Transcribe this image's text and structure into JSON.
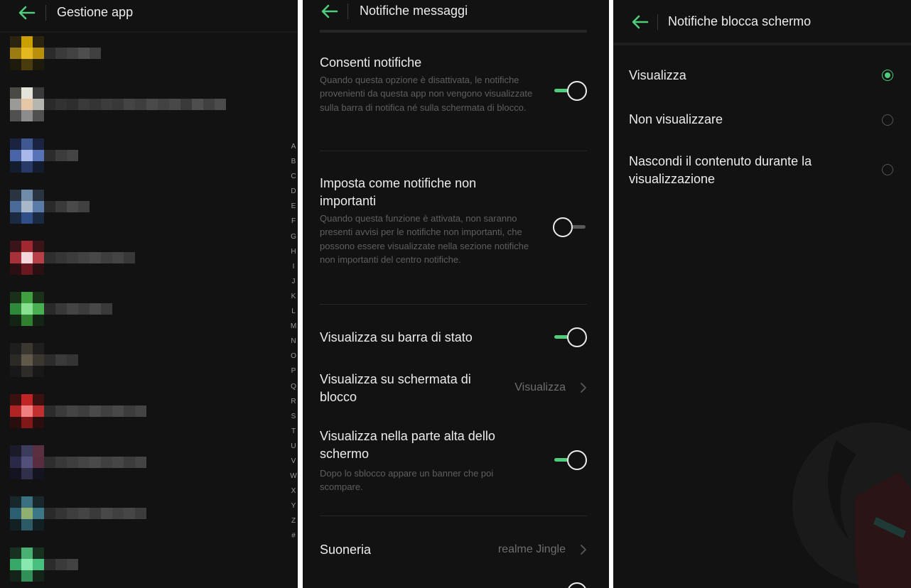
{
  "colors": {
    "accent": "#4fcc7c",
    "background": "#121212",
    "text_primary": "#ececec",
    "text_secondary": "#5f5f5f",
    "text_value": "#6e6e6e"
  },
  "panel_app_management": {
    "title": "Gestione app",
    "back_icon": "arrow-left-icon",
    "apps": [
      {
        "icon_colors": [
          [
            "#2a2410",
            "#caa000",
            "#2a2410"
          ],
          [
            "#9a7c10",
            "#e6b820",
            "#b8900c"
          ],
          [
            "#1e1a0c",
            "#4a3c0c",
            "#1e1a0c"
          ]
        ],
        "name_shades": [
          "#2c2c2c",
          "#3a3a3a",
          "#424242",
          "#4e4e4e",
          "#404040"
        ]
      },
      {
        "icon_colors": [
          [
            "#4a4a44",
            "#e4e4da",
            "#3a3a3a"
          ],
          [
            "#9a9a96",
            "#e6c8a6",
            "#b6b6b0"
          ],
          [
            "#505050",
            "#8c8c8c",
            "#505050"
          ]
        ],
        "name_shades": [
          "#2a2a2a",
          "#323232",
          "#2e2e2e",
          "#3a3a3a",
          "#343434",
          "#3c3c3c",
          "#383838",
          "#444444",
          "#3e3e3e",
          "#4a4a4a",
          "#424242",
          "#484848",
          "#3a3a3a",
          "#4e4e4e",
          "#404040",
          "#4c4c4c"
        ]
      },
      {
        "icon_colors": [
          [
            "#1a2440",
            "#405890",
            "#1a2440"
          ],
          [
            "#4a64a8",
            "#a8b8e8",
            "#5874b8"
          ],
          [
            "#141c30",
            "#2a3a68",
            "#141c30"
          ]
        ],
        "name_shades": [
          "#2c2c2c",
          "#3c3c3c",
          "#444444"
        ]
      },
      {
        "icon_colors": [
          [
            "#2a3440",
            "#708ca8",
            "#2a3440"
          ],
          [
            "#4a6a98",
            "#a8b8c8",
            "#5a7aa8"
          ],
          [
            "#1a2a40",
            "#304e88",
            "#1a2a40"
          ]
        ],
        "name_shades": [
          "#2a2a2a",
          "#3a3a3a",
          "#4a4a4a",
          "#404040"
        ]
      },
      {
        "icon_colors": [
          [
            "#3a1418",
            "#a02830",
            "#3a1418"
          ],
          [
            "#a83038",
            "#f2d8dc",
            "#b84048"
          ],
          [
            "#2a1012",
            "#6a1820",
            "#2a1012"
          ]
        ],
        "name_shades": [
          "#2e2e2e",
          "#363636",
          "#3c3c3c",
          "#424242",
          "#484848",
          "#3e3e3e",
          "#444444",
          "#383838"
        ]
      },
      {
        "icon_colors": [
          [
            "#1a3018",
            "#40a040",
            "#1a3018"
          ],
          [
            "#2e8a3a",
            "#88e090",
            "#48b050"
          ],
          [
            "#142414",
            "#308030",
            "#142414"
          ]
        ],
        "name_shades": [
          "#2a2a2a",
          "#383838",
          "#444444",
          "#3c3c3c",
          "#484848",
          "#3a3a3a"
        ]
      },
      {
        "icon_colors": [
          [
            "#1e1e1e",
            "#3a3630",
            "#1e1e1e"
          ],
          [
            "#2c2a26",
            "#605848",
            "#3a3630"
          ],
          [
            "#181818",
            "#2e2c28",
            "#181818"
          ]
        ],
        "name_shades": [
          "#2c2c2c",
          "#3a3a3a",
          "#343434"
        ]
      },
      {
        "icon_colors": [
          [
            "#3a1010",
            "#c02424",
            "#3a1010"
          ],
          [
            "#b02424",
            "#f08080",
            "#c03030"
          ],
          [
            "#2a0e0e",
            "#801818",
            "#2a0e0e"
          ]
        ],
        "name_shades": [
          "#2c2c2c",
          "#3a3a3a",
          "#444444",
          "#3e3e3e",
          "#4a4a4a",
          "#404040",
          "#484848",
          "#3c3c3c",
          "#444444"
        ]
      },
      {
        "icon_colors": [
          [
            "#1a1a28",
            "#3c3c5c",
            "#5a3040"
          ],
          [
            "#2a2a48",
            "#50507a",
            "#5a2c40"
          ],
          [
            "#141420",
            "#30304a",
            "#141420"
          ]
        ],
        "name_shades": [
          "#2e2e2e",
          "#383838",
          "#3e3e3e",
          "#444444",
          "#4a4a4a",
          "#404040",
          "#464646",
          "#3c3c3c",
          "#444444"
        ]
      },
      {
        "icon_colors": [
          [
            "#18282a",
            "#3a7080",
            "#18282a"
          ],
          [
            "#2c6070",
            "#90b070",
            "#3a7888"
          ],
          [
            "#122024",
            "#2c5a66",
            "#122024"
          ]
        ],
        "name_shades": [
          "#2a2a2a",
          "#343434",
          "#3e3e3e",
          "#444444",
          "#3a3a3a",
          "#484848",
          "#404040",
          "#464646",
          "#3c3c3c"
        ]
      },
      {
        "icon_colors": [
          [
            "#183020",
            "#48b070",
            "#183020"
          ],
          [
            "#38a868",
            "#88e8b0",
            "#48c080"
          ],
          [
            "#142418",
            "#309058",
            "#142418"
          ]
        ],
        "name_shades": [
          "#2c2c2c",
          "#3a3a3a",
          "#424242"
        ]
      }
    ],
    "alphabet": [
      "A",
      "B",
      "C",
      "D",
      "E",
      "F",
      "G",
      "H",
      "I",
      "J",
      "K",
      "L",
      "M",
      "N",
      "O",
      "P",
      "Q",
      "R",
      "S",
      "T",
      "U",
      "V",
      "W",
      "X",
      "Y",
      "Z",
      "#"
    ]
  },
  "panel_message_notifications": {
    "title": "Notifiche messaggi",
    "back_icon": "arrow-left-icon",
    "settings": [
      {
        "title": "Consenti notifiche",
        "description": "Quando questa opzione è disattivata, le notifiche provenienti da questa app non vengono visualizzate sulla barra di notifica né sulla schermata di blocco.",
        "toggle": true
      },
      {
        "title": "Imposta come notifiche non importanti",
        "description": "Quando questa funzione è attivata, non saranno presenti avvisi per le notifiche non importanti, che possono essere visualizzate nella sezione notifiche non importanti del centro notifiche.",
        "toggle": false
      },
      {
        "title": "Visualizza su barra di stato",
        "description": "",
        "toggle": true
      },
      {
        "title": "Visualizza su schermata di blocco",
        "description": "",
        "value": "Visualizza"
      },
      {
        "title": "Visualizza nella parte alta dello schermo",
        "description": "Dopo lo sblocco appare un banner che poi scompare.",
        "toggle": true
      },
      {
        "title": "Suoneria",
        "description": "",
        "value": "realme Jingle"
      }
    ]
  },
  "panel_lockscreen_notifications": {
    "title": "Notifiche blocca schermo",
    "back_icon": "arrow-left-icon",
    "options": [
      {
        "label": "Visualizza",
        "selected": true
      },
      {
        "label": "Non visualizzare",
        "selected": false
      },
      {
        "label": "Nascondi il contenuto durante la visualizzazione",
        "selected": false
      }
    ]
  }
}
